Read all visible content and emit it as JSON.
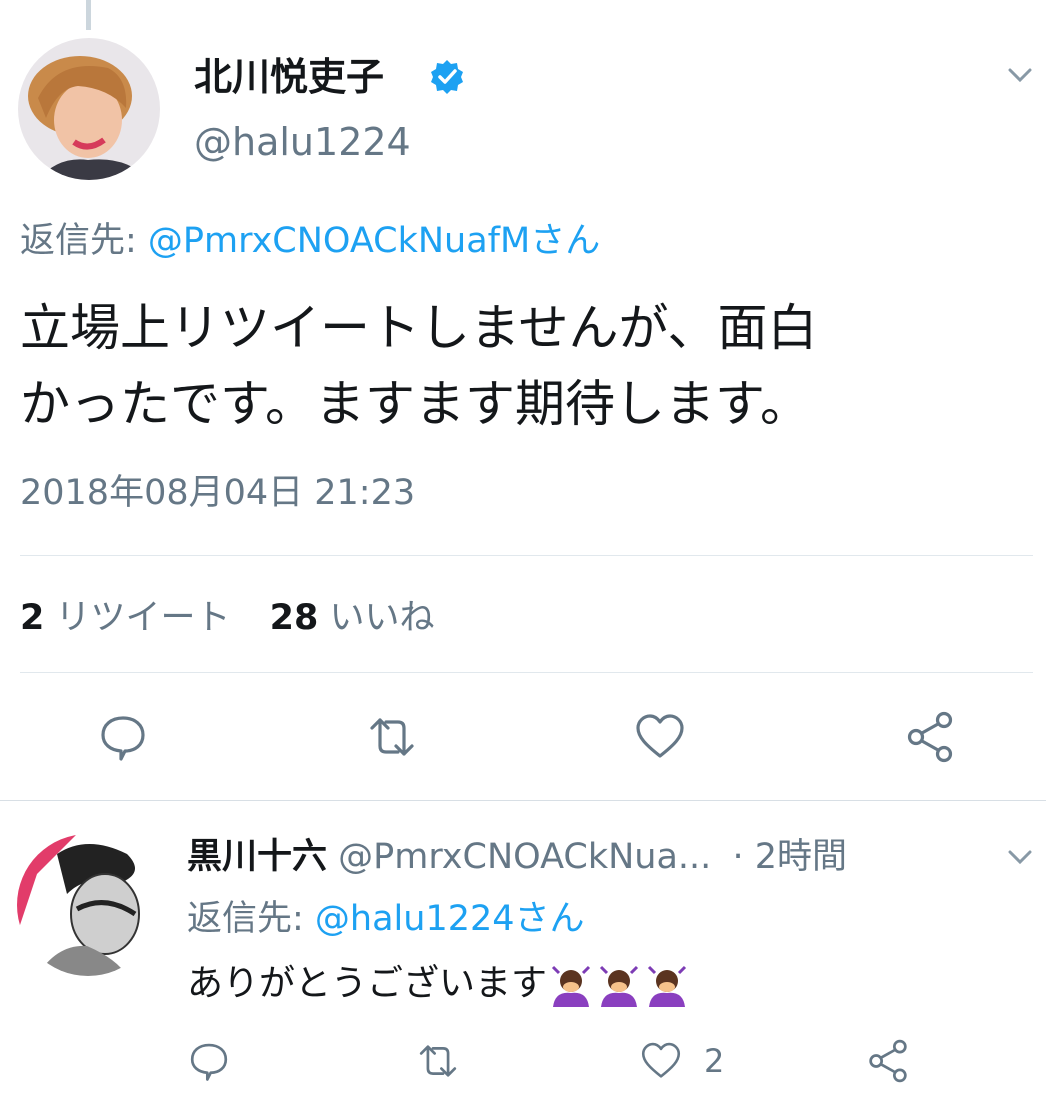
{
  "main_tweet": {
    "author_name": "北川悦吏子",
    "author_handle": "@halu1224",
    "reply_prefix": "返信先: ",
    "reply_to": "@PmrxCNOACkNuafMさん",
    "text_line1": "立場上リツイートしませんが、面白",
    "text_line2": "かったです。ますます期待します。",
    "timestamp": "2018年08月04日 21:23",
    "retweet_count": "2",
    "retweet_label": "リツイート",
    "like_count": "28",
    "like_label": "いいね"
  },
  "reply_tweet": {
    "author_name": "黒川十六",
    "author_handle": "@PmrxCNOACkNua...",
    "time": "· 2時間",
    "reply_prefix": "返信先: ",
    "reply_to": "@halu1224さん",
    "text": "ありがとうございます",
    "like_count": "2"
  },
  "icons": {
    "verified": "verified-badge-icon",
    "menu": "chevron-down-icon",
    "reply": "reply-icon",
    "retweet": "retweet-icon",
    "like": "heart-icon",
    "share": "share-icon",
    "emoji": "person-bowing-emoji"
  },
  "colors": {
    "link": "#1da1f2",
    "muted": "#657786",
    "text": "#14171a",
    "divider": "#e1e8ed"
  }
}
